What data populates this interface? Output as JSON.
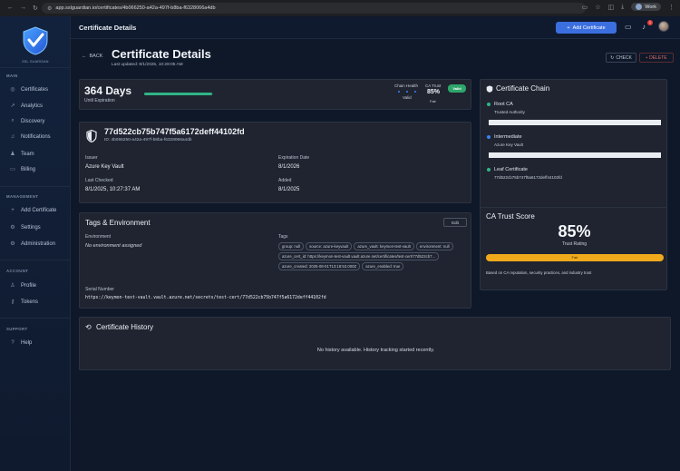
{
  "browser": {
    "url": "app.sslguardian.io/certificates/4b066250-a42a-497f-b8ba-f6328066a4db",
    "profile": "Work"
  },
  "sidebar": {
    "logo_text": "SSL GUARDIAN",
    "sections": [
      {
        "title": "MAIN",
        "items": [
          "Certificates",
          "Analytics",
          "Discovery",
          "Notifications",
          "Team",
          "Billing"
        ]
      },
      {
        "title": "MANAGEMENT",
        "items": [
          "Add Certificate",
          "Settings",
          "Administration"
        ]
      },
      {
        "title": "ACCOUNT",
        "items": [
          "Profile",
          "Tokens"
        ]
      },
      {
        "title": "SUPPORT",
        "items": [
          "Help"
        ]
      }
    ]
  },
  "topbar": {
    "title": "Certificate Details",
    "add_button": "Add Certificate",
    "notification_count": "1"
  },
  "header": {
    "back": "BACK",
    "title": "Certificate Details",
    "updated": "Last updated: 8/1/2025, 10:28:05 AM",
    "check": "CHECK",
    "delete": "DELETE"
  },
  "expiry": {
    "days": "364 Days",
    "sub": "Until Expiration",
    "progress": 0.99,
    "chain_health_label": "Chain Health",
    "chain_health_value": "Valid",
    "ca_trust_label": "CA Trust",
    "ca_trust_value": "85%",
    "ca_trust_grade": "Fair",
    "status": "Valid"
  },
  "cert": {
    "id": "77d522cb75b747f5a6172deff44102fd",
    "uuid": "ID: 4b066250-a42a-497f-b8ba-f6328066a4db",
    "issuer_label": "Issuer",
    "issuer": "Azure Key Vault",
    "expiration_label": "Expiration Date",
    "expiration": "8/1/2026",
    "checked_label": "Last Checked",
    "checked": "8/1/2025, 10:27:37 AM",
    "added_label": "Added",
    "added": "8/1/2025"
  },
  "tags_env": {
    "title": "Tags & Environment",
    "edit": "Edit",
    "env_label": "Environment",
    "env_value": "No environment assigned",
    "tags_label": "Tags",
    "tags": [
      "group: null",
      "source: azure-keyvault",
      "azure_vault: keymon-test-vault",
      "environment: null",
      "azure_cert_id: https://keymon-test-vault.vault.azure.net/certificates/test-cert/77d522cb7...",
      "azure_created: 2025-08-01T13:18:53.000Z",
      "azure_enabled: true"
    ],
    "serial_label": "Serial Number",
    "serial": "https://keymon-test-vault.vault.azure.net/secrets/test-cert/77d522cb75b747f5a6172deff44102fd"
  },
  "chain": {
    "title": "Certificate Chain",
    "nodes": [
      {
        "name": "Root CA",
        "meta": "Trusted Authority",
        "color": "#2fb487"
      },
      {
        "name": "Intermediate",
        "meta": "Azure Key Vault",
        "color": "#3b82f6"
      },
      {
        "name": "Leaf Certificate",
        "meta": "77d522cb75b747f5a6172deff44102fd",
        "color": "#2fb487"
      }
    ]
  },
  "trust": {
    "title": "CA Trust Score",
    "score": "85%",
    "rating_label": "Trust Rating",
    "grade": "Fair",
    "note": "Based on CA reputation, security practices, and industry trust"
  },
  "history": {
    "title": "Certificate History",
    "empty": "No history available. History tracking started recently."
  }
}
